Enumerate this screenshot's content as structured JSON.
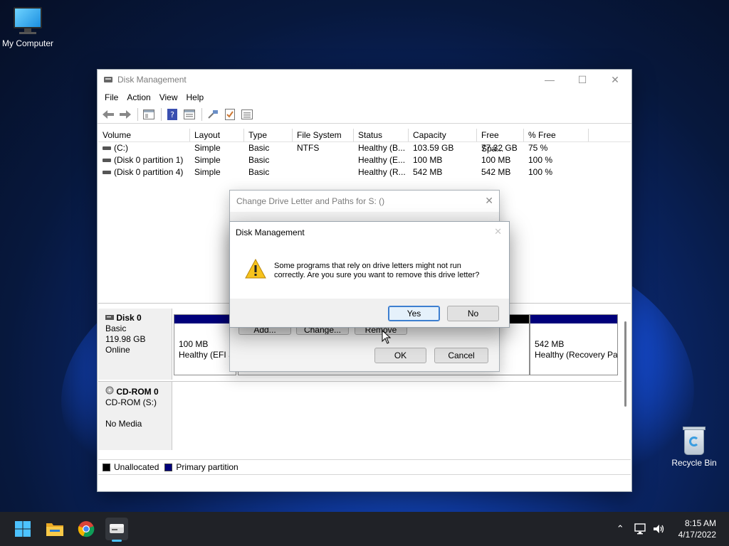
{
  "desktop": {
    "icons": [
      {
        "label": "My Computer",
        "icon": "monitor-icon"
      },
      {
        "label": "Recycle Bin",
        "icon": "recycle-bin-icon"
      }
    ]
  },
  "window": {
    "title": "Disk Management",
    "menu": [
      "File",
      "Action",
      "View",
      "Help"
    ],
    "toolbar": [
      "back-arrow-icon",
      "forward-arrow-icon",
      "console-tree-icon",
      "help-icon",
      "properties-icon",
      "connect-icon",
      "check-icon",
      "list-icon"
    ]
  },
  "volumes": {
    "columns": [
      "Volume",
      "Layout",
      "Type",
      "File System",
      "Status",
      "Capacity",
      "Free Spa...",
      "% Free"
    ],
    "rows": [
      [
        "(C:)",
        "Simple",
        "Basic",
        "NTFS",
        "Healthy (B...",
        "103.59 GB",
        "77.32 GB",
        "75 %"
      ],
      [
        "(Disk 0 partition 1)",
        "Simple",
        "Basic",
        "",
        "Healthy (E...",
        "100 MB",
        "100 MB",
        "100 %"
      ],
      [
        "(Disk 0 partition 4)",
        "Simple",
        "Basic",
        "",
        "Healthy (R...",
        "542 MB",
        "542 MB",
        "100 %"
      ]
    ]
  },
  "disks": {
    "disk0": {
      "name": "Disk 0",
      "type": "Basic",
      "size": "119.98 GB",
      "status": "Online"
    },
    "cdrom0": {
      "name": "CD-ROM 0",
      "type": "CD-ROM (S:)",
      "media": "No Media"
    },
    "partitions": [
      {
        "size": "100 MB",
        "status": "Healthy (EFI S"
      },
      {
        "size": "542 MB",
        "status": "Healthy (Recovery Pa"
      }
    ]
  },
  "legend": {
    "unallocated": "Unallocated",
    "primary": "Primary partition"
  },
  "change_dialog": {
    "title": "Change Drive Letter and Paths for S: ()",
    "add": "Add...",
    "change": "Change...",
    "remove": "Remove",
    "ok": "OK",
    "cancel": "Cancel"
  },
  "confirm_dialog": {
    "title": "Disk Management",
    "line1": "Some programs that rely on drive letters might not run",
    "line2": "correctly. Are you sure you want to remove this drive letter?",
    "yes": "Yes",
    "no": "No"
  },
  "taskbar": {
    "apps": [
      "start-icon",
      "file-explorer-icon",
      "chrome-icon",
      "disk-management-icon"
    ],
    "time": "8:15 AM",
    "date": "4/17/2022"
  }
}
